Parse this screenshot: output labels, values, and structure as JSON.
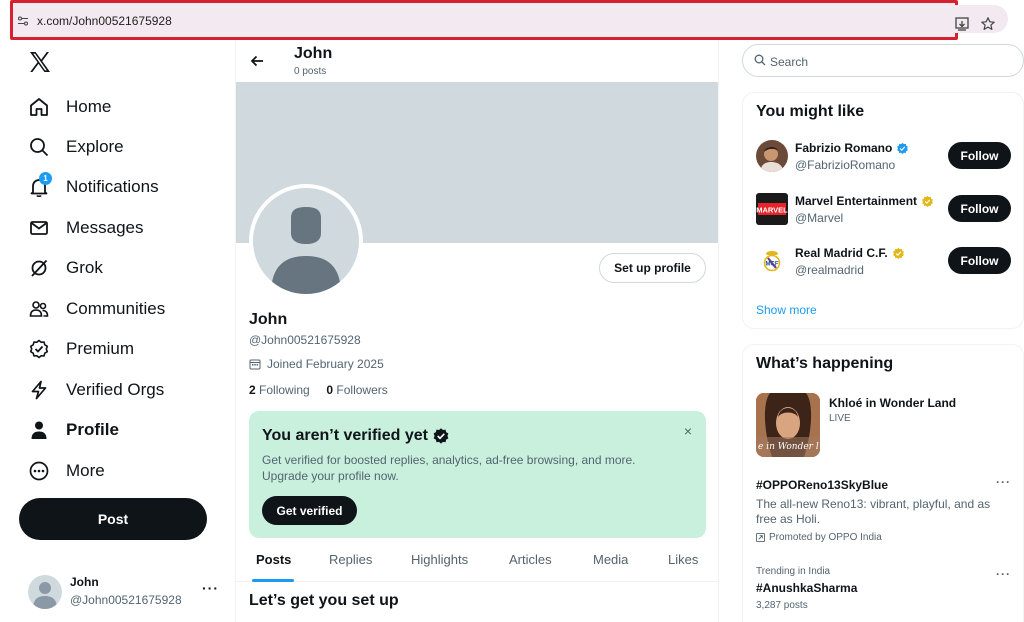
{
  "browser": {
    "url": "x.com/John00521675928"
  },
  "nav": {
    "items": [
      {
        "label": "Home",
        "icon": "home-icon"
      },
      {
        "label": "Explore",
        "icon": "search-icon"
      },
      {
        "label": "Notifications",
        "icon": "bell-icon",
        "badge": "1"
      },
      {
        "label": "Messages",
        "icon": "envelope-icon"
      },
      {
        "label": "Grok",
        "icon": "grok-icon"
      },
      {
        "label": "Communities",
        "icon": "people-icon"
      },
      {
        "label": "Premium",
        "icon": "premium-icon"
      },
      {
        "label": "Verified Orgs",
        "icon": "lightning-icon"
      },
      {
        "label": "Profile",
        "icon": "person-icon",
        "active": true
      },
      {
        "label": "More",
        "icon": "more-circle-icon"
      }
    ],
    "post_label": "Post",
    "account": {
      "name": "John",
      "handle": "@John00521675928",
      "more": "···"
    }
  },
  "profile": {
    "header_name": "John",
    "header_posts": "0 posts",
    "setup_label": "Set up profile",
    "name": "John",
    "handle": "@John00521675928",
    "joined": "Joined February 2025",
    "following_count": "2",
    "following_label": " Following",
    "followers_count": "0",
    "followers_label": " Followers"
  },
  "verify": {
    "title": "You aren’t verified yet",
    "text": "Get verified for boosted replies, analytics, ad-free browsing, and more. Upgrade your profile now.",
    "button": "Get verified",
    "close": "×"
  },
  "tabs": [
    "Posts",
    "Replies",
    "Highlights",
    "Articles",
    "Media",
    "Likes"
  ],
  "setup_heading": "Let’s get you set up",
  "search": {
    "placeholder": "Search"
  },
  "might_like": {
    "title": "You might like",
    "users": [
      {
        "name": "Fabrizio Romano",
        "handle": "@FabrizioRomano",
        "badge": "blue"
      },
      {
        "name": "Marvel Entertainment",
        "handle": "@Marvel",
        "badge": "gold"
      },
      {
        "name": "Real Madrid C.F.",
        "handle": "@realmadrid",
        "badge": "gold"
      }
    ],
    "follow_label": "Follow",
    "show_more": "Show more"
  },
  "happening": {
    "title": "What’s happening",
    "feature": {
      "title": "Khloé in Wonder Land",
      "status": "LIVE",
      "image_text": "e in Wonder l"
    },
    "trends": [
      {
        "hash": "#OPPOReno13SkyBlue",
        "desc": "The all-new Reno13: vibrant, playful, and as free as Holi.",
        "promo": "Promoted by OPPO India"
      },
      {
        "meta": "Trending in India",
        "hash": "#AnushkaSharma",
        "count": "3,287 posts"
      }
    ],
    "dots": "···"
  },
  "colors": {
    "accent": "#1d9bf0",
    "verify_bg": "#c8f0dc",
    "url_highlight": "#d6222e",
    "gold_badge": "#e2b719"
  }
}
